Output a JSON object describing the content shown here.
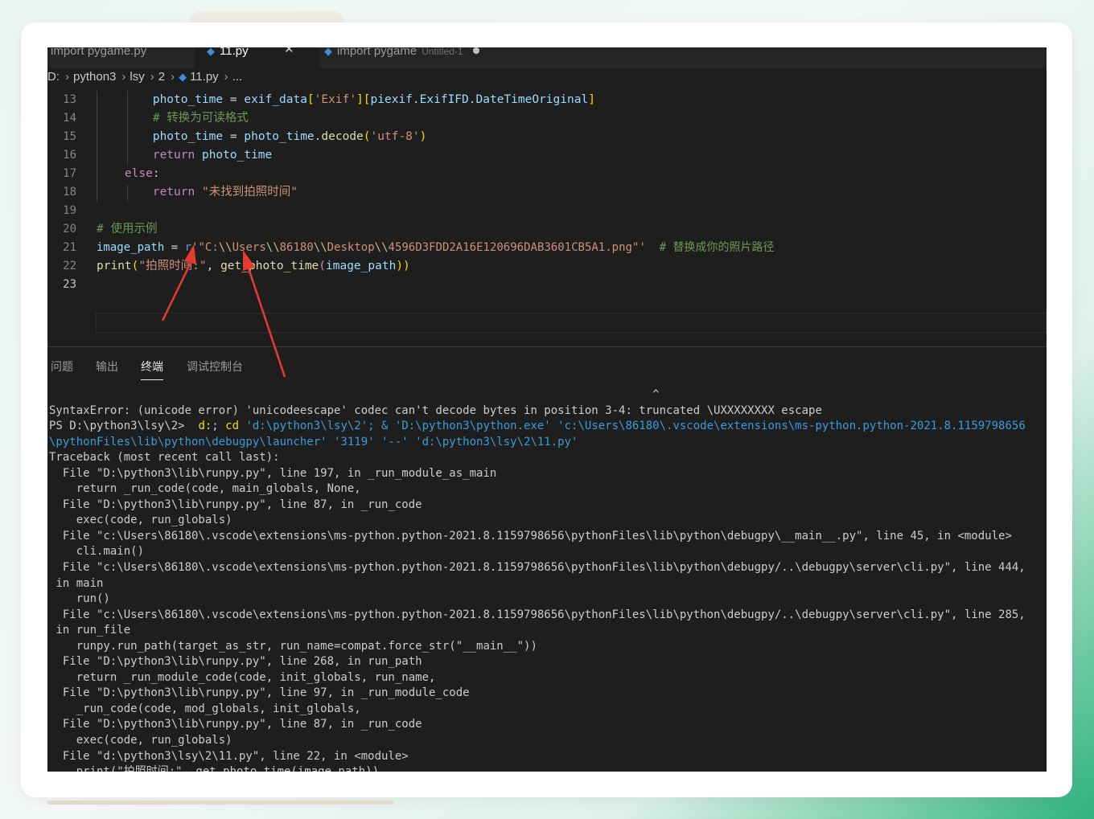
{
  "tabs": [
    {
      "label": "import pygame.py",
      "icon": "python-file-icon"
    },
    {
      "label": "11.py",
      "icon": "python-file-icon",
      "close": "✕"
    },
    {
      "label": "import pygame",
      "meta": "Untitled-1",
      "icon": "python-file-icon"
    }
  ],
  "breadcrumb": [
    "D:",
    "python3",
    "lsy",
    "2",
    "11.py",
    "..."
  ],
  "editor": {
    "line_numbers": [
      "13",
      "14",
      "15",
      "16",
      "17",
      "18",
      "19",
      "20",
      "21",
      "22",
      "23"
    ],
    "lines": {
      "l13": {
        "indent": "        ",
        "a": "photo_time",
        "b": " = ",
        "c": "exif_data",
        "d": "[",
        "e": "'Exif'",
        "f": "][",
        "g": "piexif",
        "h": ".",
        "i": "ExifIFD",
        "j": ".",
        "k": "DateTimeOriginal",
        "l": "]"
      },
      "l14": {
        "indent": "        ",
        "a": "# 转换为可读格式"
      },
      "l15": {
        "indent": "        ",
        "a": "photo_time",
        "b": " = ",
        "c": "photo_time",
        "d": ".",
        "e": "decode",
        "f": "(",
        "g": "'utf-8'",
        "h": ")"
      },
      "l16": {
        "indent": "        ",
        "a": "return",
        "b": " ",
        "c": "photo_time"
      },
      "l17": {
        "indent": "    ",
        "a": "else",
        "b": ":"
      },
      "l18": {
        "indent": "        ",
        "a": "return",
        "b": " ",
        "c": "\"未找到拍照时间\""
      },
      "l20": {
        "a": "# 使用示例"
      },
      "l21": {
        "a": "image_path",
        "b": " = ",
        "c": "r",
        "d": "'\"C:",
        "e": "\\\\",
        "f": "Users",
        "g": "\\\\",
        "h": "86180",
        "i": "\\\\",
        "j": "Desktop",
        "k": "\\\\",
        "l": "4596D3FDD2A16E120696DAB3601CB5A1.png\"'",
        "m": "  ",
        "n": "# 替换成你的照片路径"
      },
      "l22": {
        "a": "print",
        "b": "(",
        "c": "\"拍照时间:\"",
        "d": ", ",
        "e": "get_photo_time",
        "f": "(",
        "g": "image_path",
        "h": "))"
      }
    }
  },
  "panel_tabs": [
    "问题",
    "输出",
    "终端",
    "调试控制台"
  ],
  "terminal": {
    "l0": "                                                                                         ^",
    "l1": "SyntaxError: (unicode error) 'unicodeescape' codec can't decode bytes in position 3-4: truncated \\UXXXXXXXX escape",
    "l2_prompt": "PS D:\\python3\\lsy\\2>  ",
    "l2_cmd": "d:",
    "l2_sep": "; ",
    "l2_cd": "cd",
    "l2_rest": " 'd:\\python3\\lsy\\2'; & 'D:\\python3\\python.exe' 'c:\\Users\\86180\\.vscode\\extensions\\ms-python.python-2021.8.1159798656",
    "l3": "\\pythonFiles\\lib\\python\\debugpy\\launcher' '3119' '--' 'd:\\python3\\lsy\\2\\11.py'",
    "l4": "Traceback (most recent call last):",
    "l5": "  File \"D:\\python3\\lib\\runpy.py\", line 197, in _run_module_as_main",
    "l6": "    return _run_code(code, main_globals, None,",
    "l7": "  File \"D:\\python3\\lib\\runpy.py\", line 87, in _run_code",
    "l8": "    exec(code, run_globals)",
    "l9": "  File \"c:\\Users\\86180\\.vscode\\extensions\\ms-python.python-2021.8.1159798656\\pythonFiles\\lib\\python\\debugpy\\__main__.py\", line 45, in <module>",
    "l10": "    cli.main()",
    "l11": "  File \"c:\\Users\\86180\\.vscode\\extensions\\ms-python.python-2021.8.1159798656\\pythonFiles\\lib\\python\\debugpy/..\\debugpy\\server\\cli.py\", line 444,",
    "l12": " in main",
    "l13": "    run()",
    "l14": "  File \"c:\\Users\\86180\\.vscode\\extensions\\ms-python.python-2021.8.1159798656\\pythonFiles\\lib\\python\\debugpy/..\\debugpy\\server\\cli.py\", line 285,",
    "l15": " in run_file",
    "l16": "    runpy.run_path(target_as_str, run_name=compat.force_str(\"__main__\"))",
    "l17": "  File \"D:\\python3\\lib\\runpy.py\", line 268, in run_path",
    "l18": "    return _run_module_code(code, init_globals, run_name,",
    "l19": "  File \"D:\\python3\\lib\\runpy.py\", line 97, in _run_module_code",
    "l20": "    _run_code(code, mod_globals, init_globals,",
    "l21": "  File \"D:\\python3\\lib\\runpy.py\", line 87, in _run_code",
    "l22": "    exec(code, run_globals)",
    "l23": "  File \"d:\\python3\\lsy\\2\\11.py\", line 22, in <module>",
    "l24": "    print(\"拍照时间:\", get_photo_time(image_path))"
  },
  "colors": {
    "accent_arrow": "#e53a2f",
    "editor_bg": "#1e1e1e",
    "page_accent": "#2fb37f"
  }
}
